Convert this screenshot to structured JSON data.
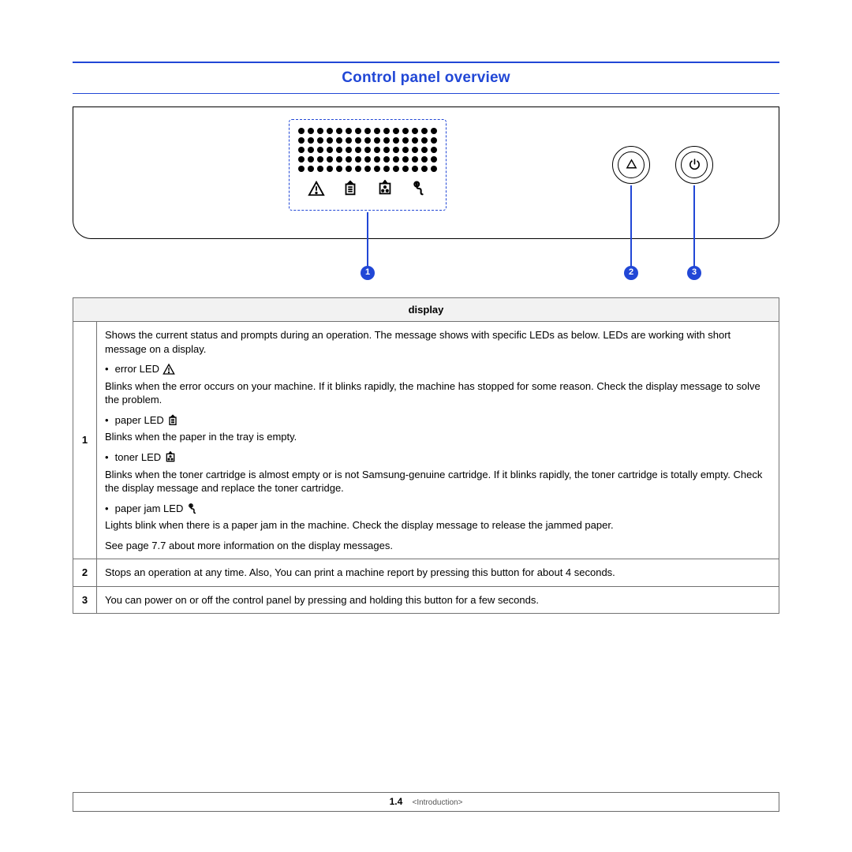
{
  "title": "Control panel overview",
  "callouts": {
    "c1": "1",
    "c2": "2",
    "c3": "3"
  },
  "table": {
    "header": "display",
    "row1": {
      "num": "1",
      "intro": "Shows the current status and prompts during an operation. The message shows with specific LEDs as below. LEDs are working with short message on a display.",
      "error_label": "error LED",
      "error_desc": "Blinks when the error occurs on your machine. If it blinks rapidly, the machine has stopped for some reason. Check the display message to solve the problem.",
      "paper_label": "paper LED",
      "paper_desc": "Blinks when the paper in the tray is empty.",
      "toner_label": "toner LED",
      "toner_desc": "Blinks when the toner cartridge is almost empty or is not Samsung-genuine cartridge. If it blinks rapidly, the toner cartridge is totally empty. Check the display message and replace the toner cartridge.",
      "jam_label": "paper jam LED",
      "jam_desc": "Lights blink when there is a paper jam in the machine. Check the display message to release the jammed paper.",
      "seepage": "See page 7.7 about more information on the display messages."
    },
    "row2": {
      "num": "2",
      "text": "Stops an operation at any time. Also, You can print a machine report by pressing this button for about 4 seconds."
    },
    "row3": {
      "num": "3",
      "text": "You can power on or off the control panel by pressing and holding this button for a few seconds."
    }
  },
  "footer": {
    "page": "1.4",
    "chapter": "<Introduction>"
  }
}
